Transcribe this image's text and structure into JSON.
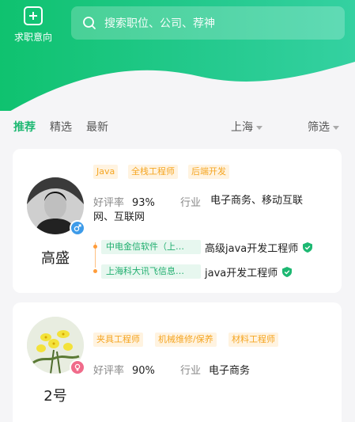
{
  "header": {
    "intent_label": "求职意向",
    "search_placeholder": "搜索职位、公司、荐神"
  },
  "tabs": [
    {
      "label": "推荐",
      "active": true
    },
    {
      "label": "精选",
      "active": false
    },
    {
      "label": "最新",
      "active": false
    }
  ],
  "filters": {
    "city": "上海",
    "filter": "筛选"
  },
  "candidates": [
    {
      "name": "高盛",
      "gender": "male",
      "tags": [
        "Java",
        "全栈工程师",
        "后端开发"
      ],
      "rating_label": "好评率",
      "rating_value": "93%",
      "industry_label": "行业",
      "industry_value": "电子商务、移动互联网、互联网",
      "experience": [
        {
          "company": "中电金信软件（上…",
          "title": "高级java开发工程师"
        },
        {
          "company": "上海科大讯飞信息…",
          "title": "java开发工程师"
        }
      ]
    },
    {
      "name": "2号",
      "gender": "female",
      "tags": [
        "夹具工程师",
        "机械维修/保养",
        "材料工程师"
      ],
      "rating_label": "好评率",
      "rating_value": "90%",
      "industry_label": "行业",
      "industry_value": "电子商务"
    }
  ],
  "colors": {
    "brand_green": "#1db872",
    "tag_orange": "#f5a623",
    "male_blue": "#3d9be9",
    "female_pink": "#f06b8a"
  }
}
